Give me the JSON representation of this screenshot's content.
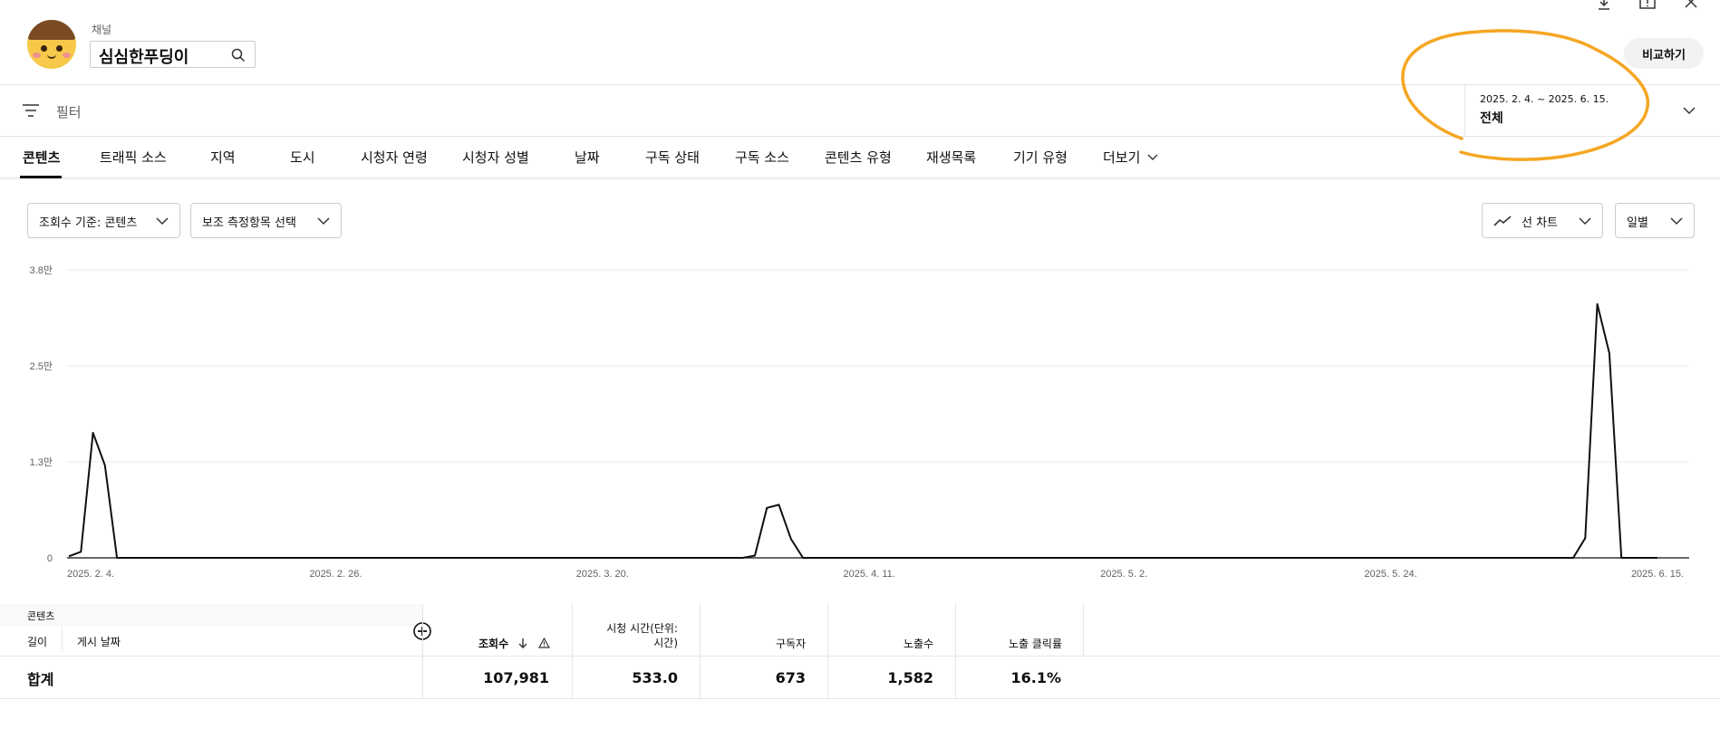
{
  "header": {
    "channel_caption": "채널",
    "channel_name": "심심한푸딩이",
    "compare_label": "비교하기"
  },
  "filter": {
    "label": "필터",
    "date_range": "2025. 2. 4. ~ 2025. 6. 15.",
    "date_preset": "전체"
  },
  "tabs": [
    {
      "label": "콘텐츠",
      "active": true
    },
    {
      "label": "트래픽 소스"
    },
    {
      "label": "지역"
    },
    {
      "label": "도시"
    },
    {
      "label": "시청자 연령"
    },
    {
      "label": "시청자 성별"
    },
    {
      "label": "날짜"
    },
    {
      "label": "구독 상태"
    },
    {
      "label": "구독 소스"
    },
    {
      "label": "콘텐츠 유형"
    },
    {
      "label": "재생목록"
    },
    {
      "label": "기기 유형"
    },
    {
      "label": "더보기"
    }
  ],
  "controls": {
    "metric_dropdown": "조회수 기준: 콘텐츠",
    "secondary_dropdown": "보조 측정항목 선택",
    "chart_type_dropdown": "선 차트",
    "interval_dropdown": "일별"
  },
  "chart_data": {
    "type": "line",
    "y_ticks": [
      "0",
      "1.3만",
      "2.5만",
      "3.8만"
    ],
    "ylim": [
      0,
      38000
    ],
    "x_ticks": [
      "2025. 2. 4.",
      "2025. 2. 26.",
      "2025. 3. 20.",
      "2025. 4. 11.",
      "2025. 5. 2.",
      "2025. 5. 24.",
      "2025. 6. 15."
    ],
    "x_start": "2025-02-04",
    "x_end": "2025-06-15",
    "series": [
      {
        "values": [
          200,
          800,
          16500,
          12200,
          0,
          0,
          0,
          0,
          0,
          0,
          0,
          0,
          0,
          0,
          0,
          0,
          0,
          0,
          0,
          0,
          0,
          0,
          0,
          0,
          0,
          0,
          0,
          0,
          0,
          0,
          0,
          0,
          0,
          0,
          0,
          0,
          0,
          0,
          0,
          0,
          0,
          0,
          0,
          0,
          0,
          0,
          0,
          0,
          0,
          0,
          0,
          0,
          0,
          0,
          0,
          0,
          0,
          300,
          6600,
          7000,
          2500,
          0,
          0,
          0,
          0,
          0,
          0,
          0,
          0,
          0,
          0,
          0,
          0,
          0,
          0,
          0,
          0,
          0,
          0,
          0,
          0,
          0,
          0,
          0,
          0,
          0,
          0,
          0,
          0,
          0,
          0,
          0,
          0,
          0,
          0,
          0,
          0,
          0,
          0,
          0,
          0,
          0,
          0,
          0,
          0,
          0,
          0,
          0,
          0,
          0,
          0,
          0,
          0,
          0,
          0,
          0,
          0,
          0,
          0,
          0,
          0,
          0,
          0,
          0,
          0,
          0,
          2600,
          33500,
          27000,
          0,
          0,
          0,
          0
        ],
        "color": "#0f0f0f"
      }
    ],
    "grid": true
  },
  "table": {
    "group_header": "콘텐츠",
    "col_length": "길이",
    "col_publish_date": "게시 날짜",
    "col_views": "조회수",
    "col_watch_time": "시청 시간(단위: 시간)",
    "col_subscribers": "구독자",
    "col_impressions": "노출수",
    "col_ctr": "노출 클릭률",
    "total_label": "합계",
    "total_views": "107,981",
    "total_watch_time": "533.0",
    "total_subscribers": "673",
    "total_impressions": "1,582",
    "total_ctr": "16.1%"
  },
  "annotation": {
    "color": "#f5a623"
  }
}
